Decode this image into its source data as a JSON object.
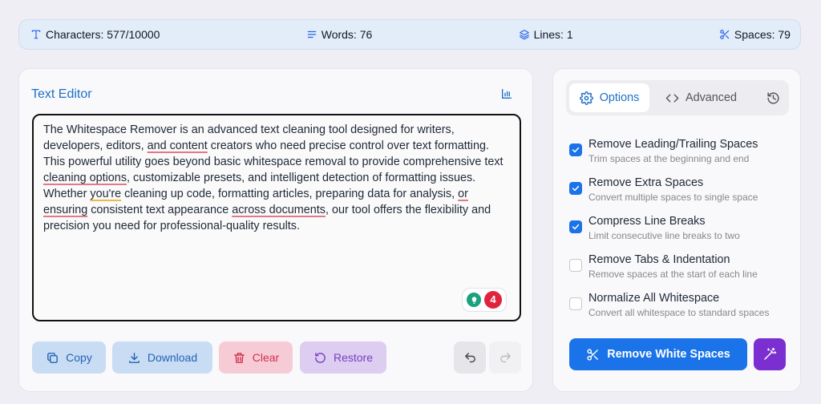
{
  "stats": {
    "characters_label": "Characters: 577/10000",
    "words_label": "Words: 76",
    "lines_label": "Lines: 1",
    "spaces_label": "Spaces: 79"
  },
  "editor": {
    "title": "Text Editor",
    "text_segments": [
      {
        "text": "The Whitespace Remover is an advanced text cleaning tool designed for writers, developers, editors, ",
        "mark": ""
      },
      {
        "text": "and  content",
        "mark": "spell"
      },
      {
        "text": " creators who need precise control over text formatting. This powerful utility goes beyond basic whitespace removal to provide comprehensive text ",
        "mark": ""
      },
      {
        "text": "cleaning  options",
        "mark": "spell"
      },
      {
        "text": ", customizable presets, and intelligent detection of formatting issues. Whether ",
        "mark": ""
      },
      {
        "text": "you're",
        "mark": "grammar"
      },
      {
        "text": " cleaning up code, formatting articles, preparing data for analysis, ",
        "mark": ""
      },
      {
        "text": "or  ensuring",
        "mark": "spell"
      },
      {
        "text": " consistent text appearance ",
        "mark": ""
      },
      {
        "text": "across  documents",
        "mark": "spell"
      },
      {
        "text": ", our tool offers the flexibility and precision you need for professional-quality results.",
        "mark": ""
      }
    ],
    "error_count": "4",
    "buttons": {
      "copy": "Copy",
      "download": "Download",
      "clear": "Clear",
      "restore": "Restore"
    }
  },
  "options_panel": {
    "tabs": [
      {
        "label": "Options",
        "icon": "gear-icon",
        "active": true
      },
      {
        "label": "Advanced",
        "icon": "code-icon",
        "active": false
      },
      {
        "label": "",
        "icon": "history-icon",
        "active": false
      }
    ],
    "options": [
      {
        "label": "Remove Leading/Trailing Spaces",
        "description": "Trim spaces at the beginning and end",
        "checked": true
      },
      {
        "label": "Remove Extra Spaces",
        "description": "Convert multiple spaces to single space",
        "checked": true
      },
      {
        "label": "Compress Line Breaks",
        "description": "Limit consecutive line breaks to two",
        "checked": true
      },
      {
        "label": "Remove Tabs & Indentation",
        "description": "Remove spaces at the start of each line",
        "checked": false
      },
      {
        "label": "Normalize All Whitespace",
        "description": "Convert all whitespace to standard spaces",
        "checked": false
      }
    ],
    "primary_action": "Remove White Spaces"
  },
  "colors": {
    "accent": "#1a73e8",
    "magic": "#7b2fd0",
    "error": "#e0243e"
  }
}
